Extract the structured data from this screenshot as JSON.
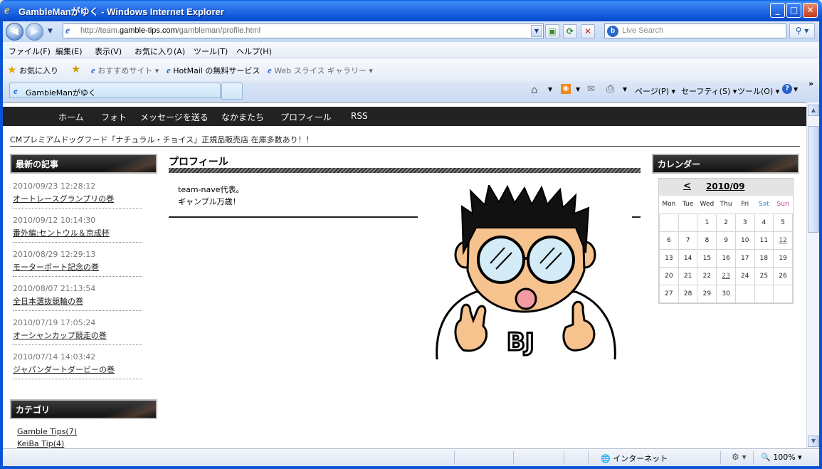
{
  "window": {
    "title": "GambleManがゆく - Windows Internet Explorer",
    "min_label": "_",
    "max_label": "□",
    "close_label": "✕"
  },
  "address": {
    "url_prefix": "http://team.",
    "url_domain": "gamble-tips.com",
    "url_suffix": "/gambleman/profile.html",
    "search_placeholder": "Live Search"
  },
  "menu": [
    "ファイル(F)",
    "編集(E)",
    "表示(V)",
    "お気に入り(A)",
    "ツール(T)",
    "ヘルプ(H)"
  ],
  "favorites": {
    "label": "お気に入り",
    "items": [
      "おすすめサイト ▾",
      "HotMail の無料サービス",
      "Web スライス ギャラリー ▾"
    ]
  },
  "tab": {
    "title": "GambleManがゆく"
  },
  "commands": [
    "ページ(P) ▾",
    "セーフティ(S) ▾",
    "ツール(O) ▾"
  ],
  "site_nav": [
    "ホーム",
    "フォト",
    "メッセージを送る",
    "なかまたち",
    "プロフィール",
    "RSS"
  ],
  "promo": "CMプレミアムドッグフード「ナチュラル・チョイス」正規品販売店 在庫多数あり！！",
  "sidebar": {
    "recent_heading": "最新の記事",
    "posts": [
      {
        "date": "2010/09/23 12:28:12",
        "title": "オートレースグランプリの巻"
      },
      {
        "date": "2010/09/12 10:14:30",
        "title": "番外編:セントウル＆京成杯"
      },
      {
        "date": "2010/08/29 12:29:13",
        "title": "モーターボート記念の巻"
      },
      {
        "date": "2010/08/07 21:13:54",
        "title": "全日本選抜競輪の巻"
      },
      {
        "date": "2010/07/19 17:05:24",
        "title": "オーシャンカップ競走の巻"
      },
      {
        "date": "2010/07/14 14:03:42",
        "title": "ジャパンダートダービーの巻"
      }
    ],
    "category_heading": "カテゴリ",
    "categories": [
      "Gamble Tips(7)",
      "KeiBa Tip(4)"
    ]
  },
  "main": {
    "heading": "プロフィール",
    "bio_line1": "team-nave代表。",
    "bio_line2": "ギャンブル万歳！",
    "avatar_text": "BJ"
  },
  "calendar": {
    "heading": "カレンダー",
    "prev": "<",
    "month": "2010/09",
    "days_of_week": [
      "Mon",
      "Tue",
      "Wed",
      "Thu",
      "Fri",
      "Sat",
      "Sun"
    ],
    "weeks": [
      [
        "",
        "",
        "1",
        "2",
        "3",
        "4",
        "5"
      ],
      [
        "6",
        "7",
        "8",
        "9",
        "10",
        "11",
        "12"
      ],
      [
        "13",
        "14",
        "15",
        "16",
        "17",
        "18",
        "19"
      ],
      [
        "20",
        "21",
        "22",
        "23",
        "24",
        "25",
        "26"
      ],
      [
        "27",
        "28",
        "29",
        "30",
        "",
        "",
        ""
      ]
    ],
    "linked_days": [
      "12",
      "23"
    ]
  },
  "status": {
    "zone": "インターネット",
    "zoom": "100%"
  },
  "colors": {
    "titlebar": "#0b53d6",
    "site_nav_bg": "#222222",
    "sat": "#2b8fd1",
    "sun": "#d0338a"
  }
}
